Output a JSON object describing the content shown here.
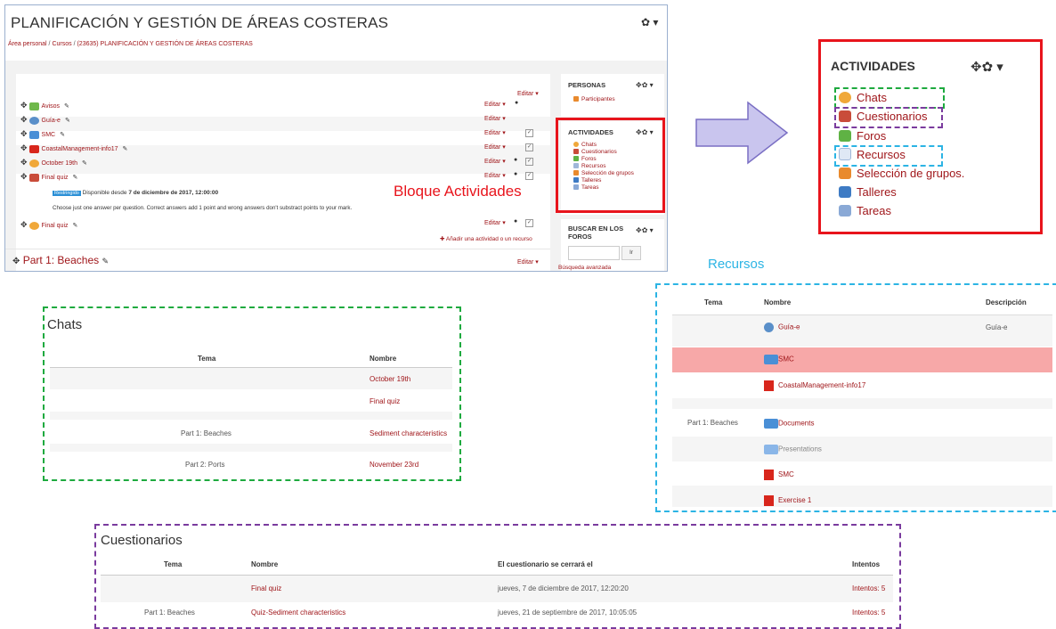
{
  "course": {
    "title": "PLANIFICACIÓN Y GESTIÓN DE ÁREAS COSTERAS",
    "breadcrumb": [
      "Área personal",
      "Cursos",
      "(23635) PLANIFICACIÓN Y GESTIÓN DE ÁREAS COSTERAS"
    ],
    "editar": "Editar",
    "activities": [
      {
        "name": "Avisos",
        "icon": "forum-icon"
      },
      {
        "name": "Guía-e",
        "icon": "url-icon"
      },
      {
        "name": "SMC",
        "icon": "folder-icon"
      },
      {
        "name": "CoastalManagement-info17",
        "icon": "pdf-icon"
      },
      {
        "name": "October 19th",
        "icon": "chat-icon"
      },
      {
        "name": "Final quiz",
        "icon": "quiz-icon"
      },
      {
        "name": "Final quiz",
        "icon": "chat-icon"
      }
    ],
    "restricted_badge": "Restringido",
    "restriction_text_pre": "Disponible desde",
    "restriction_date": "7 de diciembre de 2017, 12:00:00",
    "quiz_note": "Choose just one answer per question. Correct answers add 1 point and wrong answers don't substract points to your mark.",
    "add_activity": "Añadir una actividad o un recurso",
    "section_title": "Part 1: Beaches",
    "sidebar": {
      "personas_title": "PERSONAS",
      "participantes": "Participantes",
      "actividades_title": "ACTIVIDADES",
      "actividades_items": [
        "Chats",
        "Cuestionarios",
        "Foros",
        "Recursos",
        "Selección de grupos",
        "Talleres",
        "Tareas"
      ],
      "buscar_title": "BUSCAR EN LOS FOROS",
      "buscar_button": "Ir",
      "busqueda_avanzada": "Búsqueda avanzada"
    }
  },
  "annotation_label": "Bloque Actividades",
  "zoom": {
    "title": "ACTIVIDADES",
    "items": [
      {
        "name": "Chats",
        "icon": "chat-icon",
        "color": "#f0a83a"
      },
      {
        "name": "Cuestionarios",
        "icon": "quiz-icon",
        "color": "#c94c3a"
      },
      {
        "name": "Foros",
        "icon": "forum-icon",
        "color": "#5fb244"
      },
      {
        "name": "Recursos",
        "icon": "file-icon",
        "color": "#9fb7d9"
      },
      {
        "name": "Selección de grupos.",
        "icon": "group-icon",
        "color": "#e98a2d"
      },
      {
        "name": "Talleres",
        "icon": "workshop-icon",
        "color": "#3e7bc4"
      },
      {
        "name": "Tareas",
        "icon": "assign-icon",
        "color": "#8aa9d6"
      }
    ]
  },
  "recursos_label": "Recursos",
  "chats_table": {
    "title": "Chats",
    "headers": [
      "Tema",
      "Nombre"
    ],
    "rows": [
      {
        "tema": "",
        "nombre": "October 19th"
      },
      {
        "tema": "",
        "nombre": "Final quiz"
      },
      {
        "tema": "Part 1: Beaches",
        "nombre": "Sediment characteristics"
      },
      {
        "tema": "Part 2: Ports",
        "nombre": "November 23rd"
      }
    ]
  },
  "recursos_table": {
    "headers": [
      "Tema",
      "Nombre",
      "Descripción"
    ],
    "rows": [
      {
        "tema": "",
        "nombre": "Guía-e",
        "descripcion": "Guía-e",
        "icon": "url-icon"
      },
      {
        "tema": "",
        "nombre": "SMC",
        "descripcion": "",
        "icon": "folder-icon"
      },
      {
        "tema": "",
        "nombre": "CoastalManagement-info17",
        "descripcion": "",
        "icon": "pdf-icon"
      },
      {
        "tema": "Part 1: Beaches",
        "nombre": "Documents",
        "descripcion": "",
        "icon": "folder-icon"
      },
      {
        "tema": "",
        "nombre": "Presentations",
        "descripcion": "",
        "icon": "folder-icon"
      },
      {
        "tema": "",
        "nombre": "SMC",
        "descripcion": "",
        "icon": "pdf-icon"
      },
      {
        "tema": "",
        "nombre": "Exercise 1",
        "descripcion": "",
        "icon": "pdf-icon"
      }
    ]
  },
  "quiz_table": {
    "title": "Cuestionarios",
    "headers": [
      "Tema",
      "Nombre",
      "El cuestionario se cerrará el",
      "Intentos"
    ],
    "rows": [
      {
        "tema": "",
        "nombre": "Final quiz",
        "cierre": "jueves, 7 de diciembre de 2017, 12:20:20",
        "intentos": "Intentos: 5"
      },
      {
        "tema": "Part 1: Beaches",
        "nombre": "Quiz-Sediment characteristics",
        "cierre": "jueves, 21 de septiembre de 2017, 10:05:05",
        "intentos": "Intentos: 5"
      }
    ]
  }
}
